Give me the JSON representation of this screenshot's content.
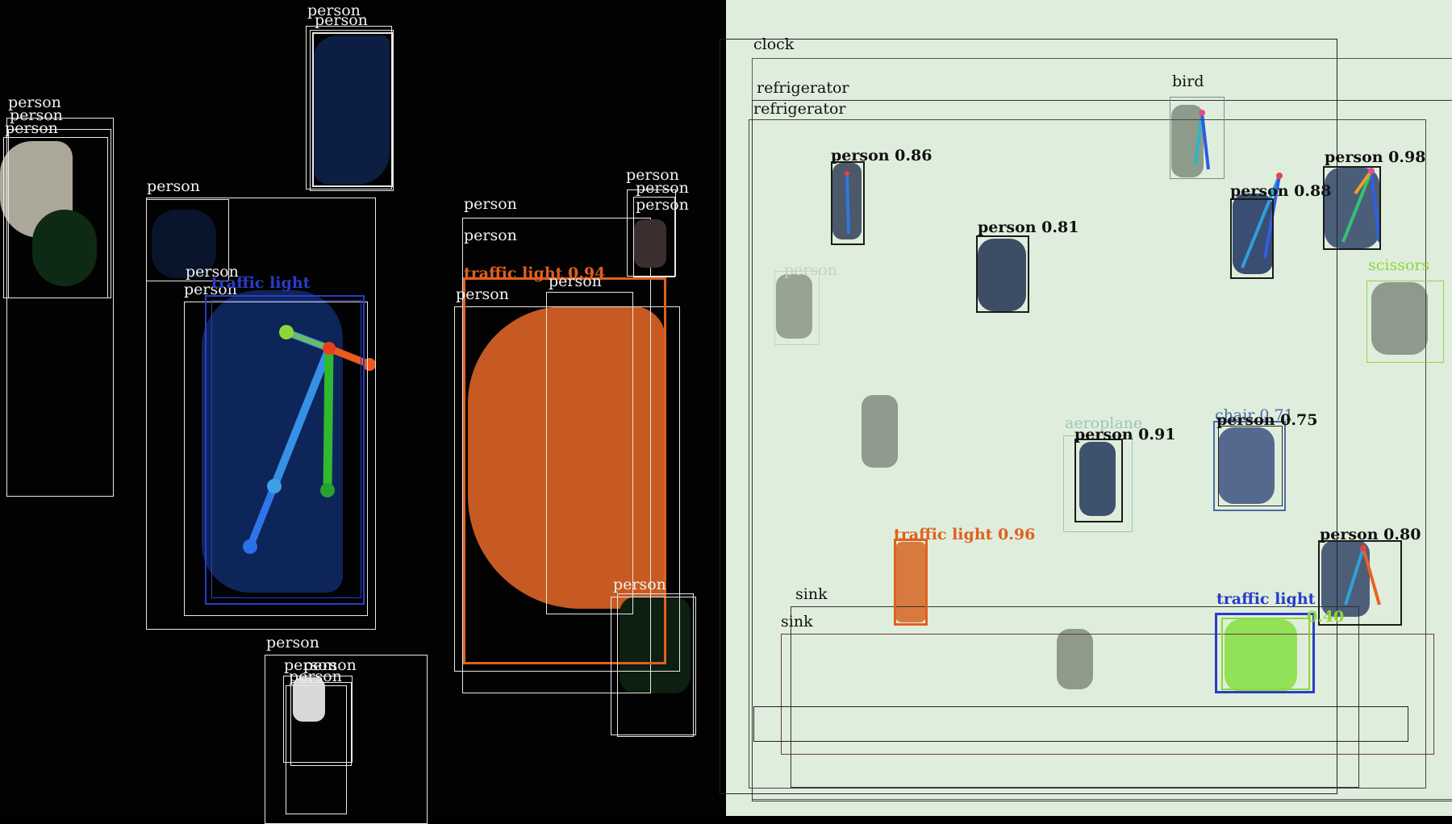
{
  "left_panel": {
    "labels": {
      "person_a": "person",
      "person_b": "person",
      "person_c": "person",
      "person_d": "person",
      "person_e": "person",
      "person_f": "person",
      "person_g": "person",
      "person_h": "person",
      "person_i": "person",
      "person_j": "person",
      "person_k": "person",
      "person_l": "person",
      "person_m": "person",
      "person_n": "person",
      "person_o": "person",
      "person_p": "person",
      "person_q": "person",
      "traffic_light_blue": "traffic light",
      "traffic_light_orange": "traffic light 0.94",
      "person_r": "person",
      "person_s": "person",
      "person_t": "person"
    }
  },
  "right_panel": {
    "labels": {
      "clock": "clock",
      "refrigerator_1": "refrigerator",
      "refrigerator_2": "refrigerator",
      "bird": "bird",
      "person_086": "person 0.86",
      "person_098": "person 0.98",
      "person_081": "person 0.81",
      "person_088": "person 0.88",
      "person_faint": "person",
      "scissors": "scissors",
      "aeroplane": "aeroplane",
      "person_091": "person 0.91",
      "chair": "chair 0.71",
      "person_075": "person 0.75",
      "traffic_light_096": "traffic light 0.96",
      "person_080": "person 0.80",
      "sink_1": "sink",
      "sink_2": "sink",
      "traffic_light_blue": "traffic light",
      "green_label": "0.40"
    }
  },
  "colors": {
    "left_background": "#020202",
    "right_background": "#dfeedc",
    "orange": "#e0601e",
    "blue_label": "#2a3cc8",
    "green": "#8fd63a"
  }
}
